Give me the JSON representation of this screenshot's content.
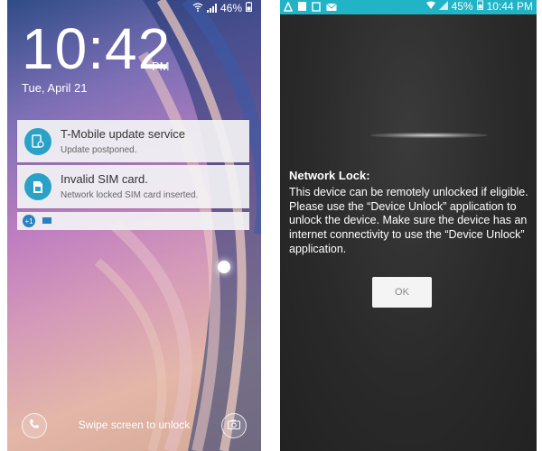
{
  "lock_screen": {
    "status": {
      "battery": "46%"
    },
    "time": "10:42",
    "ampm": "PM",
    "date": "Tue, April 21",
    "notifications": [
      {
        "title": "T-Mobile update service",
        "subtitle": "Update postponed.",
        "icon": "update-icon"
      },
      {
        "title": "Invalid SIM card.",
        "subtitle": "Network locked SIM card inserted.",
        "icon": "sim-icon"
      }
    ],
    "more_badge": "+1",
    "swipe_text": "Swipe screen to unlock"
  },
  "network_lock_screen": {
    "status": {
      "battery": "45%",
      "time": "10:44 PM"
    },
    "dialog": {
      "title": "Network Lock:",
      "message": "This device can be remotely unlocked if eligible. Please use the “Device Unlock” application to unlock the device. Make sure the device has an internet connectivity to use the “Device Unlock” application.",
      "ok_label": "OK"
    }
  },
  "colors": {
    "status_bar_teal": "#21b4c6",
    "notif_icon": "#2aa2c8"
  }
}
